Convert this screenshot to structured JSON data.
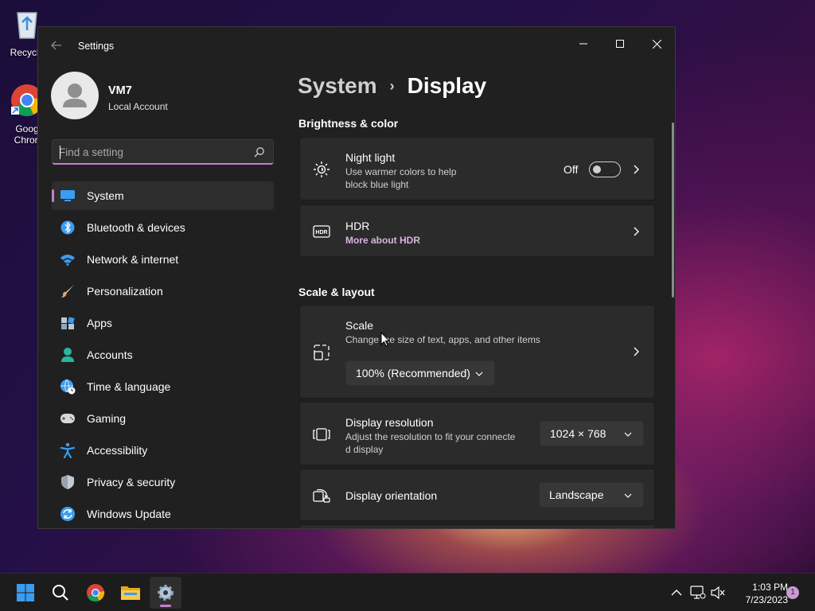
{
  "desktop": {
    "recycle_label": "Recycle",
    "chrome_label_1": "Goog",
    "chrome_label_2": "Chron"
  },
  "window": {
    "title": "Settings",
    "back_icon": "arrow-left-icon",
    "controls": [
      "minimize-icon",
      "maximize-icon",
      "close-icon"
    ]
  },
  "profile": {
    "name": "VM7",
    "account_type": "Local Account"
  },
  "search": {
    "placeholder": "Find a setting"
  },
  "sidebar": {
    "items": [
      {
        "label": "System",
        "icon": "monitor-icon",
        "selected": true
      },
      {
        "label": "Bluetooth & devices",
        "icon": "bluetooth-icon"
      },
      {
        "label": "Network & internet",
        "icon": "wifi-icon"
      },
      {
        "label": "Personalization",
        "icon": "brush-icon"
      },
      {
        "label": "Apps",
        "icon": "apps-icon"
      },
      {
        "label": "Accounts",
        "icon": "person-icon"
      },
      {
        "label": "Time & language",
        "icon": "globe-clock-icon"
      },
      {
        "label": "Gaming",
        "icon": "gamepad-icon"
      },
      {
        "label": "Accessibility",
        "icon": "accessibility-icon"
      },
      {
        "label": "Privacy & security",
        "icon": "shield-icon"
      },
      {
        "label": "Windows Update",
        "icon": "update-icon"
      }
    ]
  },
  "breadcrumb": {
    "parent": "System",
    "separator": "›",
    "current": "Display"
  },
  "sections": {
    "brightness": "Brightness & color",
    "scale_layout": "Scale & layout"
  },
  "night_light": {
    "title": "Night light",
    "subtitle_1": "Use warmer colors to help",
    "subtitle_2": "block blue light",
    "state_label": "Off"
  },
  "hdr": {
    "title": "HDR",
    "link": "More about HDR"
  },
  "scale": {
    "title": "Scale",
    "subtitle": "Change the size of text, apps, and other items",
    "value": "100% (Recommended)"
  },
  "resolution": {
    "title": "Display resolution",
    "subtitle_1": "Adjust the resolution to fit your connecte",
    "subtitle_2": "d display",
    "value": "1024 × 768"
  },
  "orientation": {
    "title": "Display orientation",
    "value": "Landscape"
  },
  "taskbar": {
    "time": "1:03 PM",
    "date": "7/23/2023",
    "notification_count": "1",
    "colors": {
      "accent": "#c67fd1",
      "windows_blue": "#3b9cf0"
    }
  }
}
